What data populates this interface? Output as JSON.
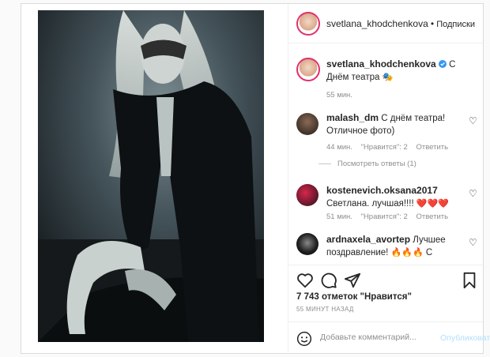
{
  "post": {
    "author": "svetlana_khodchenkova",
    "follow_label": "Подписки",
    "separator": "•"
  },
  "caption": {
    "author": "svetlana_khodchenkova",
    "text": "С Днём театра",
    "emoji": "🎭",
    "time": "55 мин."
  },
  "comments": [
    {
      "user": "malash_dm",
      "text": "С днём театра! Отличное фото)",
      "time": "44 мин.",
      "likes": "\"Нравится\": 2",
      "reply": "Ответить",
      "view_replies": "Посмотреть ответы (1)"
    },
    {
      "user": "kostenevich.oksana2017",
      "text": "Светлана. лучшая!!!!",
      "emoji": "❤️❤️❤️",
      "time": "51 мин.",
      "likes": "\"Нравится\": 2",
      "reply": "Ответить"
    },
    {
      "user": "ardnaxela_avortep",
      "text": "Лучшее поздравление!",
      "emoji1": "🔥🔥🔥",
      "text2": "С поздником!",
      "emoji2": "❤️"
    }
  ],
  "stats": {
    "likes": "7 743 отметок \"Нравится\"",
    "time": "55 МИНУТ НАЗАД"
  },
  "add_comment": {
    "placeholder": "Добавьте комментарий...",
    "publish": "Опубликовать"
  },
  "colors": {
    "accent_blue": "#0095f6",
    "publish_disabled": "#b2dffc",
    "verified": "#3897f0"
  },
  "icons": [
    "heart-icon",
    "comment-icon",
    "share-icon",
    "bookmark-icon",
    "emoji-icon",
    "verified-icon"
  ]
}
